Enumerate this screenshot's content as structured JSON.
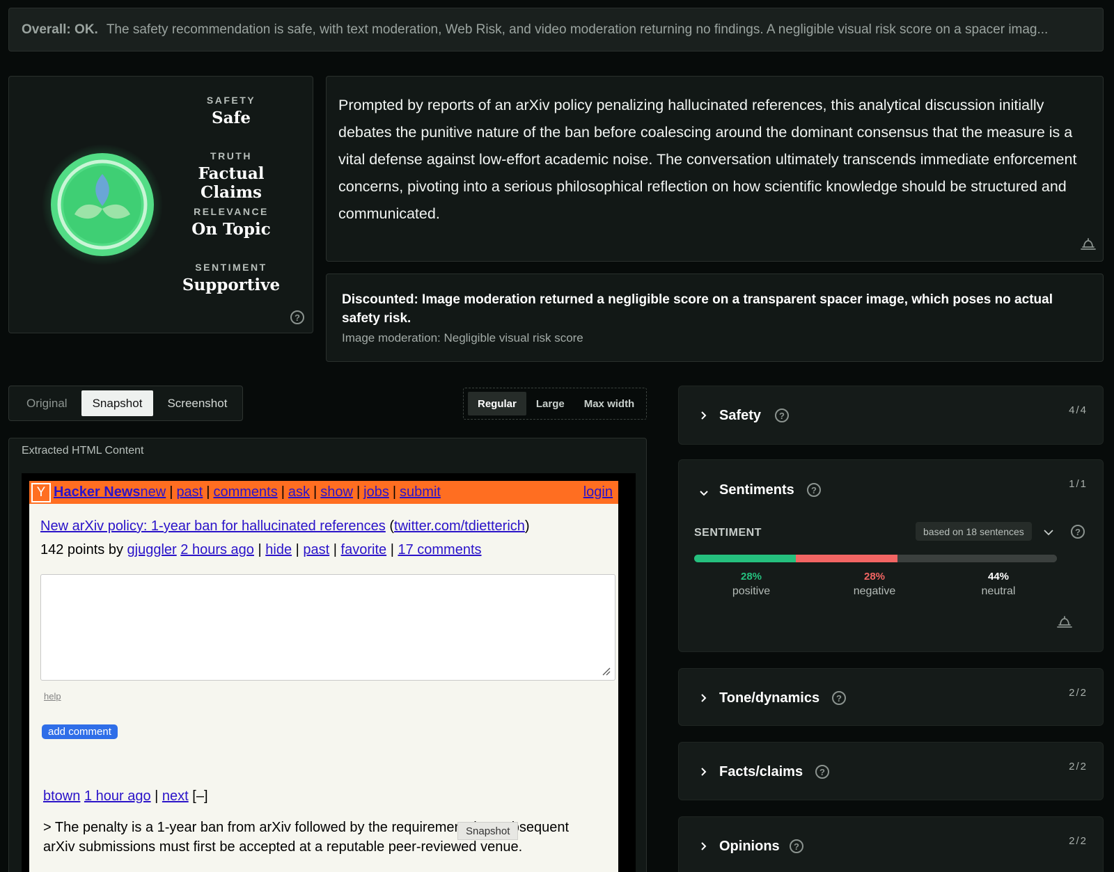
{
  "overall": {
    "label": "Overall: OK.",
    "text": "The safety recommendation is safe, with text moderation, Web Risk, and video moderation returning no findings. A negligible visual risk score on a spacer imag..."
  },
  "scorecard": {
    "metrics": [
      {
        "label": "SAFETY",
        "value": "Safe"
      },
      {
        "label": "TRUTH",
        "value": "Factual Claims"
      },
      {
        "label": "RELEVANCE",
        "value": "On Topic"
      },
      {
        "label": "SENTIMENT",
        "value": "Supportive"
      }
    ],
    "help_icon": "question-circle-icon"
  },
  "summary": {
    "text": "Prompted by reports of an arXiv policy penalizing hallucinated references, this analytical discussion initially debates the punitive nature of the ban before coalescing around the dominant consensus that the measure is a vital defense against low-effort academic noise. The conversation ultimately transcends immediate enforcement concerns, pivoting into a serious philosophical reflection on how scientific knowledge should be structured and communicated.",
    "icon": "bell-icon"
  },
  "discounted": {
    "heading": "Discounted: Image moderation returned a negligible score on a transparent spacer image, which poses no actual safety risk.",
    "sub": "Image moderation: Negligible visual risk score"
  },
  "view_tabs": {
    "items": [
      "Original",
      "Snapshot",
      "Screenshot"
    ],
    "active": "Snapshot"
  },
  "width_tabs": {
    "items": [
      "Regular",
      "Large",
      "Max width"
    ],
    "active": "Regular"
  },
  "extracted": {
    "title": "Extracted HTML Content",
    "hn": {
      "logo": "Y",
      "brand": "Hacker News",
      "nav": [
        "new",
        "past",
        "comments",
        "ask",
        "show",
        "jobs",
        "submit"
      ],
      "login": "login",
      "story_title": "New arXiv policy: 1-year ban for hallucinated references",
      "story_site": "twitter.com/tdietterich",
      "points_text": "142 points by",
      "user": "gjuggler",
      "age": "2 hours ago",
      "links": [
        "hide",
        "past",
        "favorite",
        "17 comments"
      ],
      "help": "help",
      "add_comment": "add comment",
      "comment_user": "btown",
      "comment_age": "1 hour ago",
      "comment_next": "next",
      "comment_toggle": "[–]",
      "comment_text": "> The penalty is a 1-year ban from arXiv followed by the requirement that subsequent arXiv submissions must first be accepted at a reputable peer-reviewed venue.",
      "tooltip": "Snapshot"
    }
  },
  "panels": [
    {
      "name": "Safety",
      "count": "4/4",
      "expanded": false
    },
    {
      "name": "Sentiments",
      "count": "1/1",
      "expanded": true
    },
    {
      "name": "Tone/dynamics",
      "count": "2/2",
      "expanded": false
    },
    {
      "name": "Facts/claims",
      "count": "2/2",
      "expanded": false
    },
    {
      "name": "Opinions",
      "count": "2/2",
      "expanded": false
    }
  ],
  "sentiment": {
    "label": "SENTIMENT",
    "basis": "based on 18 sentences",
    "positive": {
      "pct": "28%",
      "word": "positive",
      "value": 28,
      "color": "#25c07e"
    },
    "negative": {
      "pct": "28%",
      "word": "negative",
      "value": 28,
      "color": "#f26563"
    },
    "neutral": {
      "pct": "44%",
      "word": "neutral",
      "value": 44,
      "color": "#3b403e"
    }
  },
  "colors": {
    "accent_green": "#3fd680",
    "hn_orange": "#ff6e21",
    "link_blue": "#2a13c9"
  }
}
